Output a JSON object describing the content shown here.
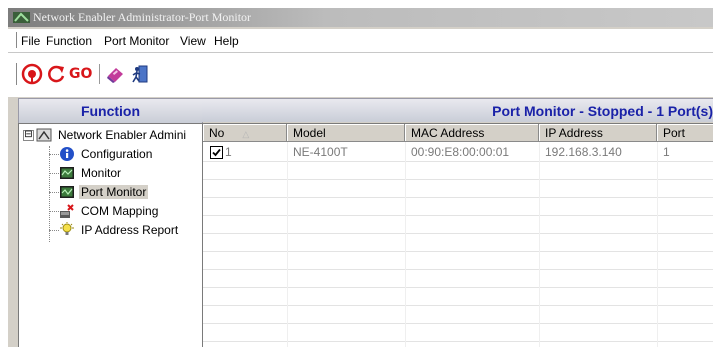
{
  "window": {
    "title": "Network Enabler Administrator-Port Monitor"
  },
  "menubar": {
    "items": [
      {
        "label": "File"
      },
      {
        "label": "Function"
      },
      {
        "label": "Port Monitor"
      },
      {
        "label": "View"
      },
      {
        "label": "Help"
      }
    ]
  },
  "toolbar": {
    "buttons": [
      {
        "icon": "broadcast-search-icon"
      },
      {
        "icon": "refresh-icon"
      },
      {
        "icon": "go-icon",
        "label": "GO"
      },
      {
        "icon": "settings-eraser-icon"
      },
      {
        "icon": "exit-icon"
      }
    ]
  },
  "function_panel": {
    "header": "Function",
    "root": {
      "label": "Network Enabler Admini",
      "expander": "⊟"
    },
    "items": [
      {
        "label": "Configuration",
        "icon": "info-icon"
      },
      {
        "label": "Monitor",
        "icon": "monitor-icon"
      },
      {
        "label": "Port Monitor",
        "icon": "port-monitor-icon",
        "selected": true
      },
      {
        "label": "COM Mapping",
        "icon": "com-mapping-icon"
      },
      {
        "label": "IP Address Report",
        "icon": "lightbulb-icon"
      }
    ]
  },
  "port_monitor": {
    "header": "Port Monitor - Stopped - 1 Port(s)",
    "columns": [
      {
        "label": "No",
        "sort": "△"
      },
      {
        "label": "Model"
      },
      {
        "label": "MAC Address"
      },
      {
        "label": "IP Address"
      },
      {
        "label": "Port"
      }
    ],
    "rows": [
      {
        "no": "1",
        "checked": true,
        "model": "NE-4100T",
        "mac": "00:90:E8:00:00:01",
        "ip": "192.168.3.140",
        "port": "1"
      }
    ]
  },
  "colors": {
    "header_text": "#1a22a8",
    "selection": "#d4d0c8",
    "go_text": "#d8161a"
  }
}
